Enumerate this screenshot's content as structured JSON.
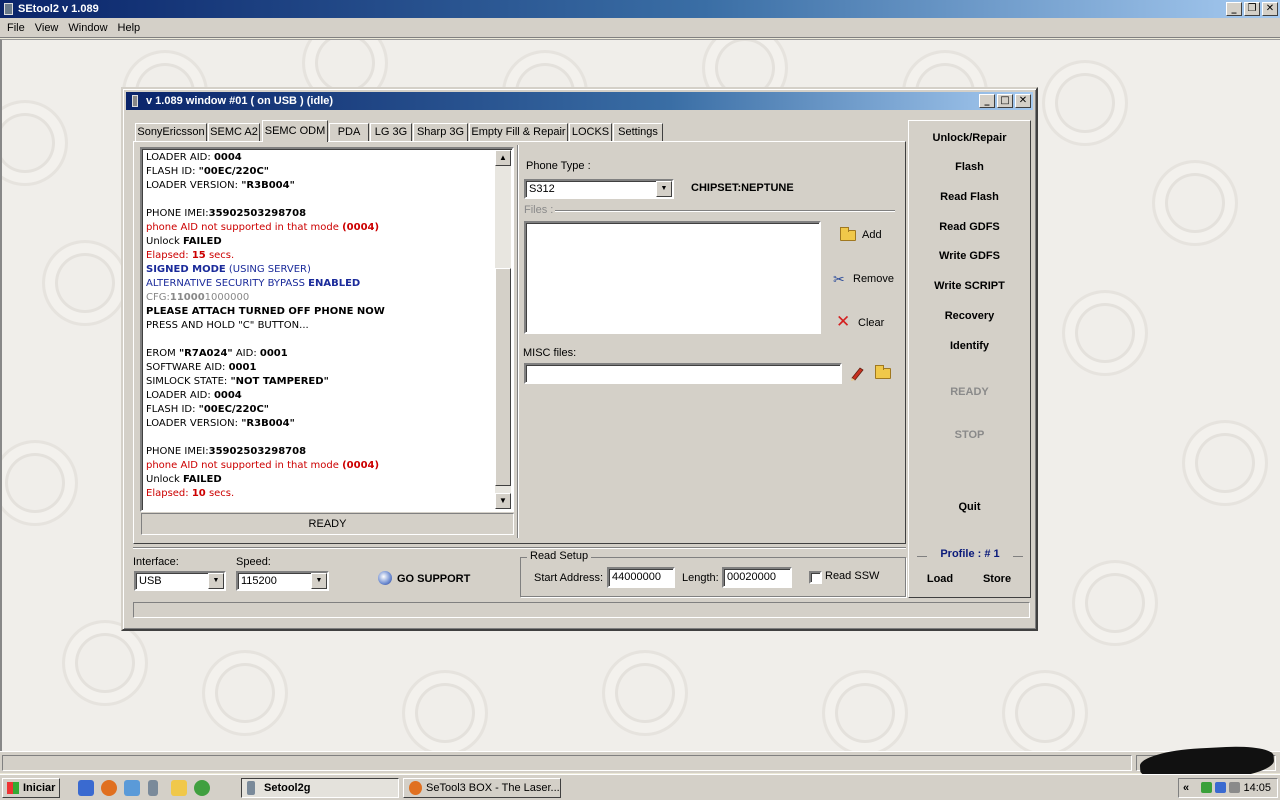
{
  "app": {
    "title": "SEtool2 v 1.089",
    "menu": [
      "File",
      "View",
      "Window",
      "Help"
    ]
  },
  "child_window": {
    "title": "v 1.089 window #01 ( on USB ) (idle)"
  },
  "tabs": [
    {
      "label": "SonyEricsson",
      "active": false
    },
    {
      "label": "SEMC A2",
      "active": false
    },
    {
      "label": "SEMC ODM",
      "active": true
    },
    {
      "label": "PDA",
      "active": false
    },
    {
      "label": "LG 3G",
      "active": false
    },
    {
      "label": "Sharp 3G",
      "active": false
    },
    {
      "label": "Empty Fill & Repair",
      "active": false
    },
    {
      "label": "LOCKS",
      "active": false
    },
    {
      "label": "Settings",
      "active": false
    }
  ],
  "log_lines": [
    {
      "text": "LOADER AID: ",
      "bold": "0004"
    },
    {
      "text": "FLASH ID: ",
      "bold": "\"00EC/220C\""
    },
    {
      "text": "LOADER VERSION: ",
      "bold": "\"R3B004\""
    },
    {
      "text": ""
    },
    {
      "text": "PHONE IMEI:",
      "bold": "35902503298708"
    },
    {
      "text": "phone AID not supported in that mode ",
      "bold": "(0004)",
      "color": "red"
    },
    {
      "text": "Unlock ",
      "bold": "FAILED"
    },
    {
      "text": "Elapsed: ",
      "bold": "15",
      "after": " secs.",
      "color": "red"
    },
    {
      "text": "SIGNED MODE",
      "after": " (USING SERVER)",
      "color": "blue",
      "boldfirst": true
    },
    {
      "text": "ALTERNATIVE SECURITY BYPASS ",
      "bold": "ENABLED",
      "color": "blue"
    },
    {
      "text": "CFG:",
      "bold": "11000",
      "after": "1000000",
      "color": "gray"
    },
    {
      "text": "PLEASE ATTACH TURNED OFF PHONE NOW",
      "boldall": true
    },
    {
      "text": "PRESS AND HOLD \"C\" BUTTON..."
    },
    {
      "text": ""
    },
    {
      "text": "EROM ",
      "bold": "\"R7A024\"",
      "after": " AID: ",
      "bold2": "0001"
    },
    {
      "text": "SOFTWARE AID: ",
      "bold": "0001"
    },
    {
      "text": "SIMLOCK STATE: ",
      "bold": "\"NOT TAMPERED\""
    },
    {
      "text": "LOADER AID: ",
      "bold": "0004"
    },
    {
      "text": "FLASH ID: ",
      "bold": "\"00EC/220C\""
    },
    {
      "text": "LOADER VERSION: ",
      "bold": "\"R3B004\""
    },
    {
      "text": ""
    },
    {
      "text": "PHONE IMEI:",
      "bold": "35902503298708"
    },
    {
      "text": "phone AID not supported in that mode ",
      "bold": "(0004)",
      "color": "red"
    },
    {
      "text": "Unlock ",
      "bold": "FAILED"
    },
    {
      "text": "Elapsed: ",
      "bold": "10",
      "after": " secs.",
      "color": "red"
    }
  ],
  "log_status": "READY",
  "phone_type": {
    "label": "Phone Type :",
    "value": "S312",
    "chipset": "CHIPSET:NEPTUNE"
  },
  "files": {
    "label": "Files :",
    "add": "Add",
    "remove": "Remove",
    "clear": "Clear"
  },
  "misc_files": {
    "label": "MISC files:",
    "value": ""
  },
  "interface": {
    "label": "Interface:",
    "value": "USB"
  },
  "speed": {
    "label": "Speed:",
    "value": "115200"
  },
  "go_support": "GO SUPPORT",
  "read_setup": {
    "label": "Read Setup",
    "start_label": "Start Address:",
    "start_value": "44000000",
    "length_label": "Length:",
    "length_value": "00020000",
    "read_ssw": "Read SSW",
    "read_ssw_checked": false
  },
  "actions": [
    "Unlock/Repair",
    "Flash",
    "Read Flash",
    "Read GDFS",
    "Write GDFS",
    "Write SCRIPT",
    "Recovery",
    "Identify"
  ],
  "state_ready": "READY",
  "state_stop": "STOP",
  "quit": "Quit",
  "profile": {
    "label": "Profile :  # 1",
    "load": "Load",
    "store": "Store"
  },
  "taskbar": {
    "start": "Iniciar",
    "tasks": [
      "Setool2g",
      "SeTool3 BOX - The Laser..."
    ],
    "clock": "14:05"
  }
}
